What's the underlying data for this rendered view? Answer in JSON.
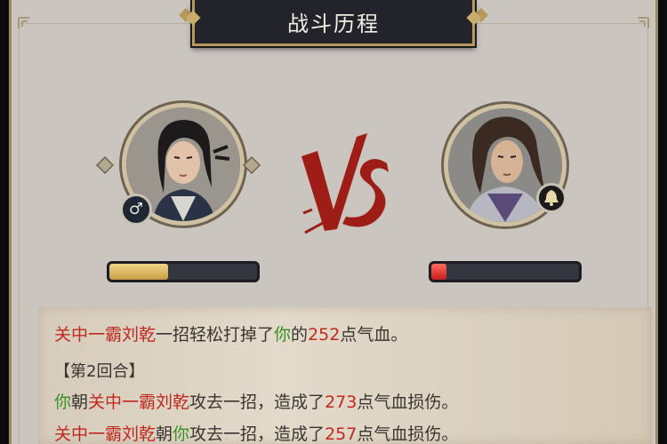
{
  "title": "战斗历程",
  "player_left": {
    "gender_symbol": "♂",
    "hp_fraction": 0.4
  },
  "player_right": {
    "badge_icon": "bell-icon",
    "hp_fraction": 0.1
  },
  "vs_text": "VS",
  "colors": {
    "enemy_name": "#c0281f",
    "self": "#3a8f25",
    "damage": "#c0281f",
    "normal": "#3a3530"
  },
  "log": {
    "line1": {
      "enemy": "关中一霸刘乾",
      "t1": "一招轻松打掉了",
      "you": "你",
      "t2": "的",
      "dmg": "252",
      "t3": "点气血。"
    },
    "round_header": "【第2回合】",
    "line3": {
      "you": "你",
      "t1": "朝",
      "enemy": "关中一霸刘乾",
      "t2": "攻去一招，造成了",
      "dmg": "273",
      "t3": "点气血损伤。"
    },
    "line4": {
      "enemy": "关中一霸刘乾",
      "t1": "朝",
      "you": "你",
      "t2": "攻去一招，造成了",
      "dmg": "257",
      "t3": "点气血损伤。"
    }
  }
}
